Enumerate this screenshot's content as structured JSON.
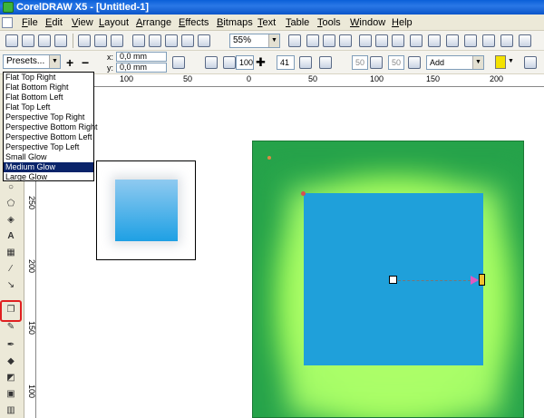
{
  "window": {
    "title": "CorelDRAW X5 - [Untitled-1]"
  },
  "menu": [
    "File",
    "Edit",
    "View",
    "Layout",
    "Arrange",
    "Effects",
    "Bitmaps",
    "Text",
    "Table",
    "Tools",
    "Window",
    "Help"
  ],
  "toolbar": {
    "zoom": "55%"
  },
  "property_bar": {
    "presets": "Presets...",
    "x_label": "x:",
    "x_value": "0,0 mm",
    "y_label": "y:",
    "y_value": "0,0 mm",
    "opacity": "100",
    "feather": "41",
    "stretch1": "50",
    "stretch2": "50",
    "blend_mode": "Add",
    "color": "#f4e200"
  },
  "presets_list": {
    "items": [
      "Flat Top Right",
      "Flat Bottom Right",
      "Flat Bottom Left",
      "Flat Top Left",
      "Perspective Top Right",
      "Perspective Bottom Right",
      "Perspective Bottom Left",
      "Perspective Top Left",
      "Small Glow",
      "Medium Glow",
      "Large Glow"
    ],
    "selected": "Medium Glow"
  },
  "rulers": {
    "horizontal": [
      "100",
      "50",
      "0",
      "50",
      "100",
      "150",
      "200"
    ],
    "vertical": [
      "250",
      "200",
      "150",
      "100"
    ]
  },
  "colors": {
    "page_green": "#26a34a",
    "glow": "#aaff6a",
    "shape_blue": "#1fa0da",
    "highlight": "#e02020"
  }
}
